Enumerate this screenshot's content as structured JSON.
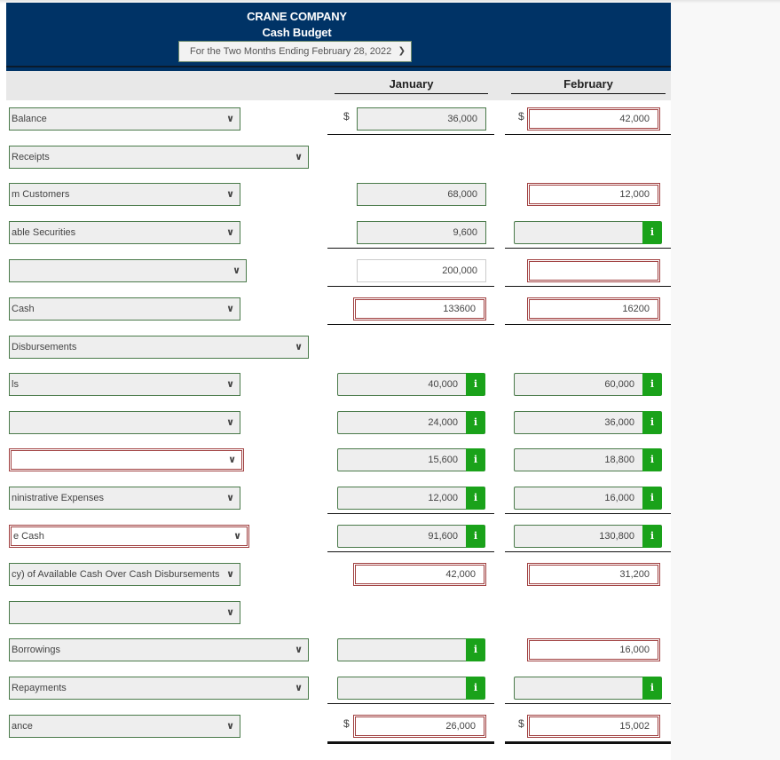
{
  "header": {
    "company": "CRANE COMPANY",
    "title": "Cash Budget",
    "period": "For the Two Months Ending February 28, 2022"
  },
  "columns": {
    "jan": "January",
    "feb": "February"
  },
  "currency_symbol": "$",
  "rows": [
    {
      "label": "Balance",
      "jan": "36,000",
      "feb": "42,000"
    },
    {
      "label": "Receipts"
    },
    {
      "label": "m Customers",
      "jan": "68,000",
      "feb": "12,000"
    },
    {
      "label": "able Securities",
      "jan": "9,600",
      "feb": ""
    },
    {
      "label": "",
      "jan": "200,000",
      "feb": ""
    },
    {
      "label": "Cash",
      "jan": "133600",
      "feb": "16200"
    },
    {
      "label": "Disbursements"
    },
    {
      "label": "ls",
      "jan": "40,000",
      "feb": "60,000"
    },
    {
      "label": "",
      "jan": "24,000",
      "feb": "36,000"
    },
    {
      "label": "",
      "jan": "15,600",
      "feb": "18,800"
    },
    {
      "label": "ninistrative Expenses",
      "jan": "12,000",
      "feb": "16,000"
    },
    {
      "label": "e Cash",
      "jan": "91,600",
      "feb": "130,800"
    },
    {
      "label": "cy) of Available Cash Over Cash Disbursements",
      "jan": "42,000",
      "feb": "31,200"
    },
    {
      "label": ""
    },
    {
      "label": "Borrowings",
      "jan": "",
      "feb": "16,000"
    },
    {
      "label": "Repayments",
      "jan": "",
      "feb": ""
    },
    {
      "label": "ance",
      "jan": "26,000",
      "feb": "15,002"
    }
  ],
  "icons": {
    "chevron": "⌄",
    "info": "i"
  }
}
